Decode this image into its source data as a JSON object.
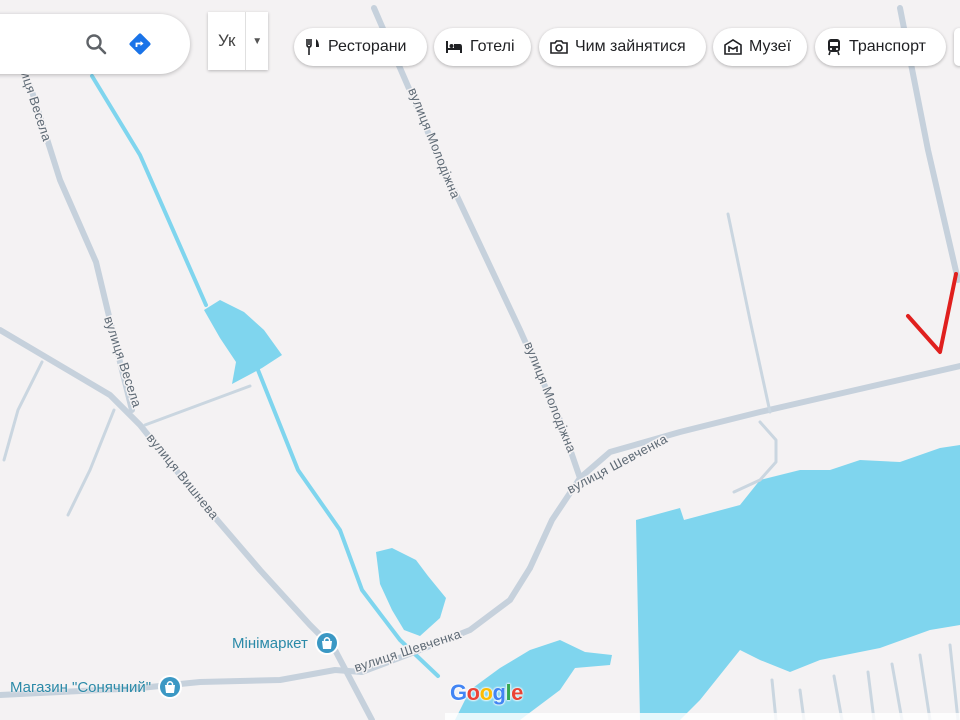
{
  "search": {
    "search_icon": "search-icon",
    "directions_icon": "directions-icon"
  },
  "input_tool": {
    "label": "Ук",
    "caret_icon": "caret-down-icon"
  },
  "categories": [
    {
      "label": "Ресторани",
      "icon": "restaurant-icon"
    },
    {
      "label": "Готелі",
      "icon": "hotel-icon"
    },
    {
      "label": "Чим зайнятися",
      "icon": "camera-icon"
    },
    {
      "label": "Музеї",
      "icon": "museum-icon"
    },
    {
      "label": "Транспорт",
      "icon": "transit-icon"
    }
  ],
  "streets": {
    "vesela": "вулиця Весела",
    "vyshneva": "вулиця Вишнева",
    "molodizhna": "вулиця Молодіжна",
    "shevchenka": "вулиця Шевченка"
  },
  "places": [
    {
      "label": "Мінімаркет",
      "icon": "shopping-bag-icon"
    },
    {
      "label": "Магазин \"Сонячний\"",
      "icon": "shopping-bag-icon"
    }
  ],
  "logo": "Google",
  "colors": {
    "land": "#f4f2f3",
    "road": "#c6d1dc",
    "water": "#7fd5ee",
    "poi": "#2b8aa8",
    "annotation": "#e0201e"
  }
}
